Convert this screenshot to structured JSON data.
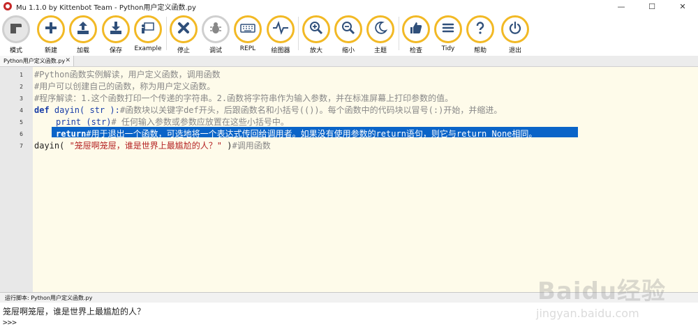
{
  "window": {
    "title": "Mu 1.1.0 by Kittenbot Team - Python用户定义函数.py",
    "controls": [
      "—",
      "☐",
      "✕"
    ]
  },
  "toolbar": {
    "buttons": [
      {
        "label": "模式",
        "icon": "mode-icon"
      },
      {
        "label": "新建",
        "icon": "plus-icon"
      },
      {
        "label": "加载",
        "icon": "upload-icon"
      },
      {
        "label": "保存",
        "icon": "download-icon"
      },
      {
        "label": "Example",
        "icon": "presentation-icon"
      },
      {
        "label": "停止",
        "icon": "stop-x-icon"
      },
      {
        "label": "调试",
        "icon": "bug-icon"
      },
      {
        "label": "REPL",
        "icon": "keyboard-icon"
      },
      {
        "label": "绘图器",
        "icon": "pulse-icon"
      },
      {
        "label": "放大",
        "icon": "zoom-in-icon"
      },
      {
        "label": "缩小",
        "icon": "zoom-out-icon"
      },
      {
        "label": "主题",
        "icon": "moon-icon"
      },
      {
        "label": "检查",
        "icon": "thumbs-up-icon"
      },
      {
        "label": "Tidy",
        "icon": "list-icon"
      },
      {
        "label": "帮助",
        "icon": "question-icon"
      },
      {
        "label": "退出",
        "icon": "power-icon"
      }
    ],
    "accent": "#f2b925"
  },
  "tab": {
    "label": "Python用户定义函数.py",
    "close": "✕"
  },
  "editor": {
    "line_numbers": [
      "1",
      "2",
      "3",
      "4",
      "5",
      "6",
      "7"
    ],
    "line1": "#Python函数实例解读，用户定义函数，调用函数",
    "line2": "#用户可以创建自己的函数，称为用户定义函数。",
    "line3": "#程序解读：1.这个函数打印一个传递的字符串。2.函数将字符串作为输入参数，并在标准屏幕上打印参数的值。",
    "line4_kw": "def",
    "line4_name": " dayin( str ):",
    "line4_comment": "#函数块以关键字def开头，后跟函数名和小括号(())。每个函数中的代码块以冒号(:)开始，并缩进。",
    "line5_code": "print (str)",
    "line5_comment": "# 任何输入参数或参数应放置在这些小括号中。",
    "line6_kw": "return",
    "line6_comment": "#用于退出一个函数，可选地将一个表达式传回给调用者。如果没有使用参数的return语句，则它与return None相同。",
    "line7_call": "dayin( ",
    "line7_str": "\"笼屉啊笼屉，谁是世界上最尴尬的人？\"",
    "line7_close": " )",
    "line7_comment": "#调用函数",
    "selection_color": "#0a64c8"
  },
  "repl": {
    "header": "运行脚本: Python用户定义函数.py",
    "output": "笼屉啊笼屉，谁是世界上最尴尬的人？",
    "prompt": ">>>"
  },
  "watermark": {
    "brand": "Baidu经验",
    "url": "jingyan.baidu.com"
  }
}
